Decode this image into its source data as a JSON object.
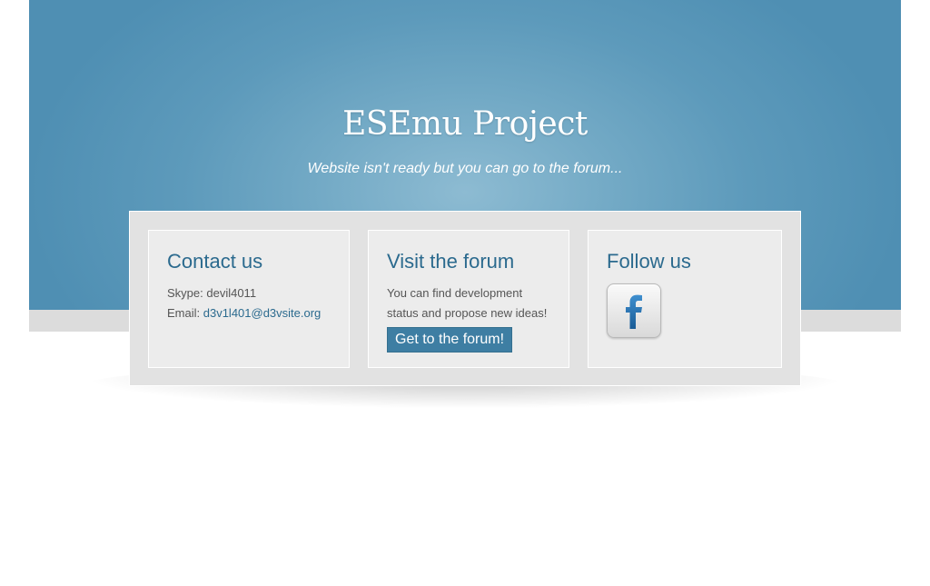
{
  "header": {
    "title": "ESEmu Project",
    "subtitle": "Website isn't ready but you can go to the forum..."
  },
  "contact": {
    "heading": "Contact us",
    "skype_label": "Skype: devil4011",
    "email_label": "Email: ",
    "email": "d3v1l401@d3vsite.org"
  },
  "forum": {
    "heading": "Visit the forum",
    "description": "You can find development status and propose new ideas!",
    "button_label": "Get to the forum!"
  },
  "social": {
    "heading": "Follow us",
    "icon": "facebook-icon"
  },
  "colors": {
    "accent": "#2b6a8e",
    "button": "#3e7ea3",
    "hero": "#5d9abb"
  }
}
